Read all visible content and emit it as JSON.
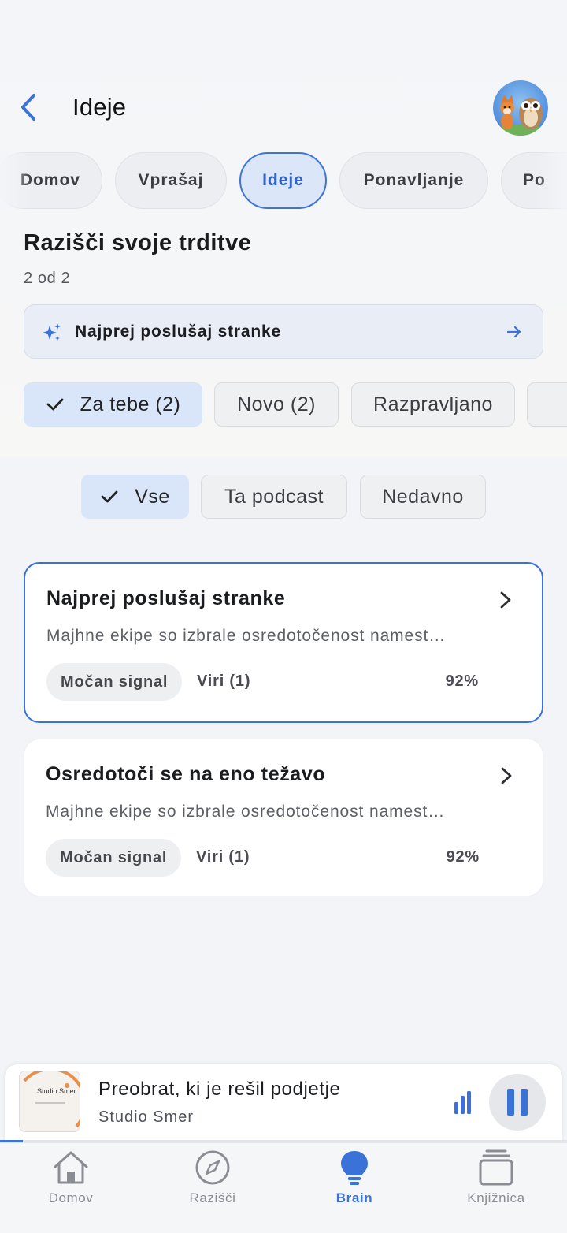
{
  "header": {
    "title": "Ideje",
    "back_label": ""
  },
  "tabs": [
    {
      "label": "Domov",
      "active": false
    },
    {
      "label": "Vprašaj",
      "active": false
    },
    {
      "label": "Ideje",
      "active": true
    },
    {
      "label": "Ponavljanje",
      "active": false
    },
    {
      "label": "Po",
      "active": false
    }
  ],
  "section": {
    "title": "Razišči svoje trditve",
    "count": "2 od 2"
  },
  "suggestion": {
    "label": "Najprej poslušaj stranke",
    "icon": "sparkle-icon"
  },
  "chips": [
    {
      "label": "Za tebe (2)",
      "selected": true
    },
    {
      "label": "Novo (2)",
      "selected": false
    },
    {
      "label": "Razpravljano",
      "selected": false
    }
  ],
  "filters": [
    {
      "label": "Vse",
      "selected": true
    },
    {
      "label": "Ta podcast",
      "selected": false
    },
    {
      "label": "Nedavno",
      "selected": false
    }
  ],
  "cards": [
    {
      "title": "Najprej poslušaj stranke",
      "description": "Majhne ekipe so izbrale osredotočenost namest…",
      "badge": "Močan signal",
      "sources": "Viri (1)",
      "percent": "92%",
      "selected": true
    },
    {
      "title": "Osredotoči se na eno težavo",
      "description": "Majhne ekipe so izbrale osredotočenost namest…",
      "badge": "Močan signal",
      "sources": "Viri (1)",
      "percent": "92%",
      "selected": false
    }
  ],
  "player": {
    "title": "Preobrat, ki je rešil podjetje",
    "subtitle": "Studio Smer",
    "cover_text": "Studio Smer",
    "progress": 0.04
  },
  "nav": [
    {
      "label": "Domov",
      "icon": "home-icon",
      "active": false
    },
    {
      "label": "Razišči",
      "icon": "compass-icon",
      "active": false
    },
    {
      "label": "Brain",
      "icon": "lightbulb-icon",
      "active": true
    },
    {
      "label": "Knjižnica",
      "icon": "library-icon",
      "active": false
    }
  ],
  "colors": {
    "accent": "#3a72d8",
    "chip_selected": "#d9e6f9",
    "background": "#f2f4f8"
  }
}
